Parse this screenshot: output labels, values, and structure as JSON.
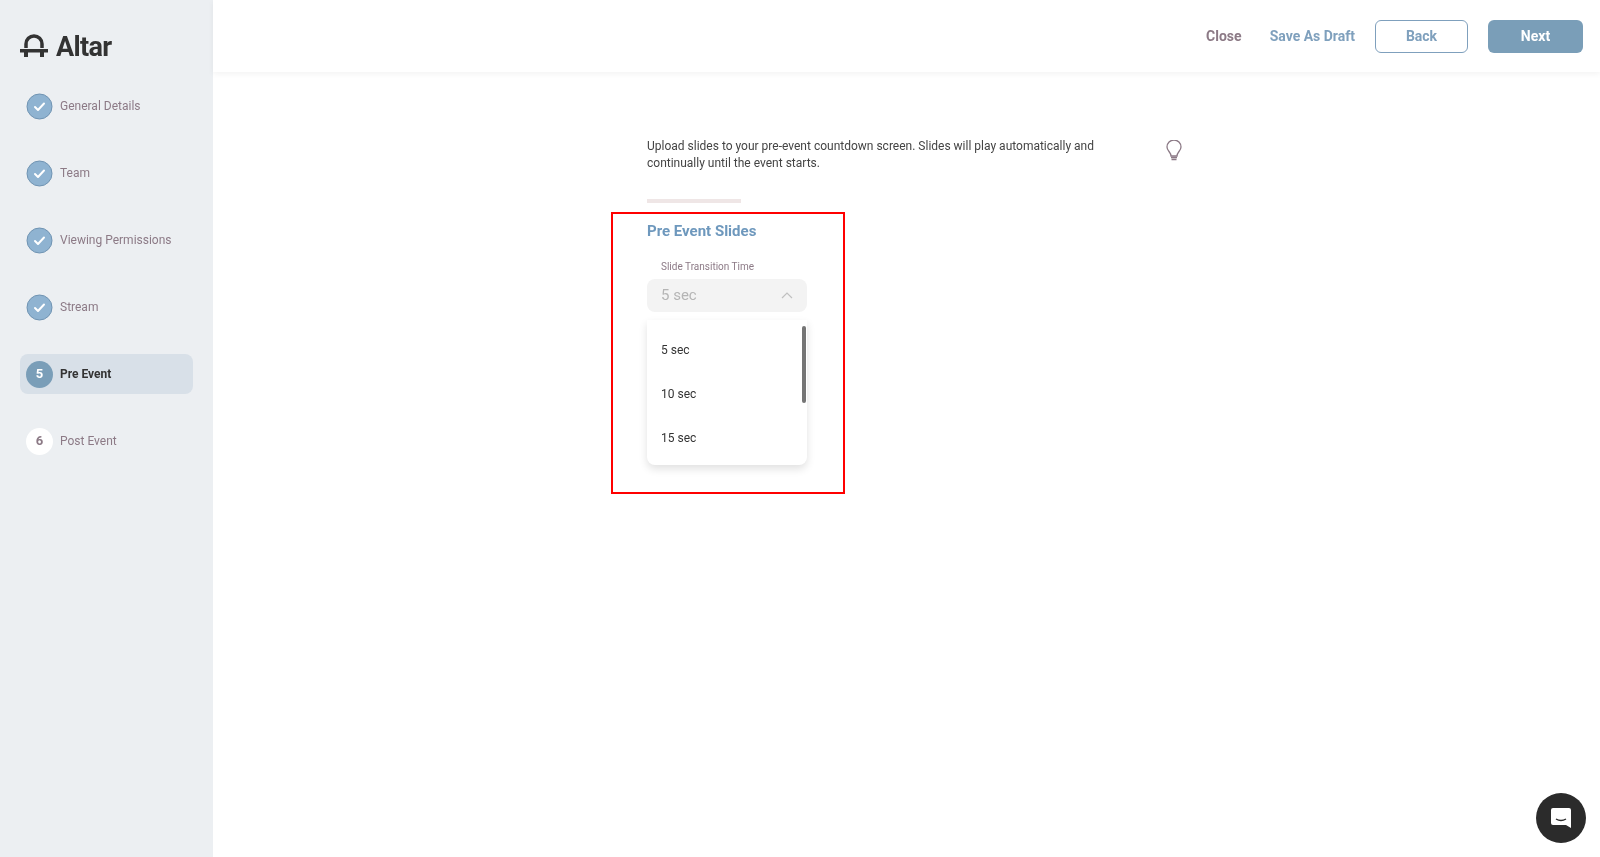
{
  "brand": {
    "name": "Altar"
  },
  "steps": [
    {
      "label": "General Details",
      "completed": true,
      "selected": false
    },
    {
      "label": "Team",
      "completed": true,
      "selected": false
    },
    {
      "label": "Viewing Permissions",
      "completed": true,
      "selected": false
    },
    {
      "label": "Stream",
      "completed": true,
      "selected": false
    },
    {
      "number": "5",
      "label": "Pre Event",
      "completed": false,
      "selected": true
    },
    {
      "number": "6",
      "label": "Post Event",
      "completed": false,
      "selected": false
    }
  ],
  "header": {
    "close": "Close",
    "save_draft": "Save As Draft",
    "back": "Back",
    "next": "Next"
  },
  "intro": "Upload slides to your pre-event countdown screen. Slides will play automatically and continually until the event starts.",
  "section": {
    "title": "Pre Event Slides",
    "field_label": "Slide Transition Time",
    "value": "5 sec",
    "expanded": true,
    "options": [
      "5 sec",
      "10 sec",
      "15 sec"
    ]
  }
}
